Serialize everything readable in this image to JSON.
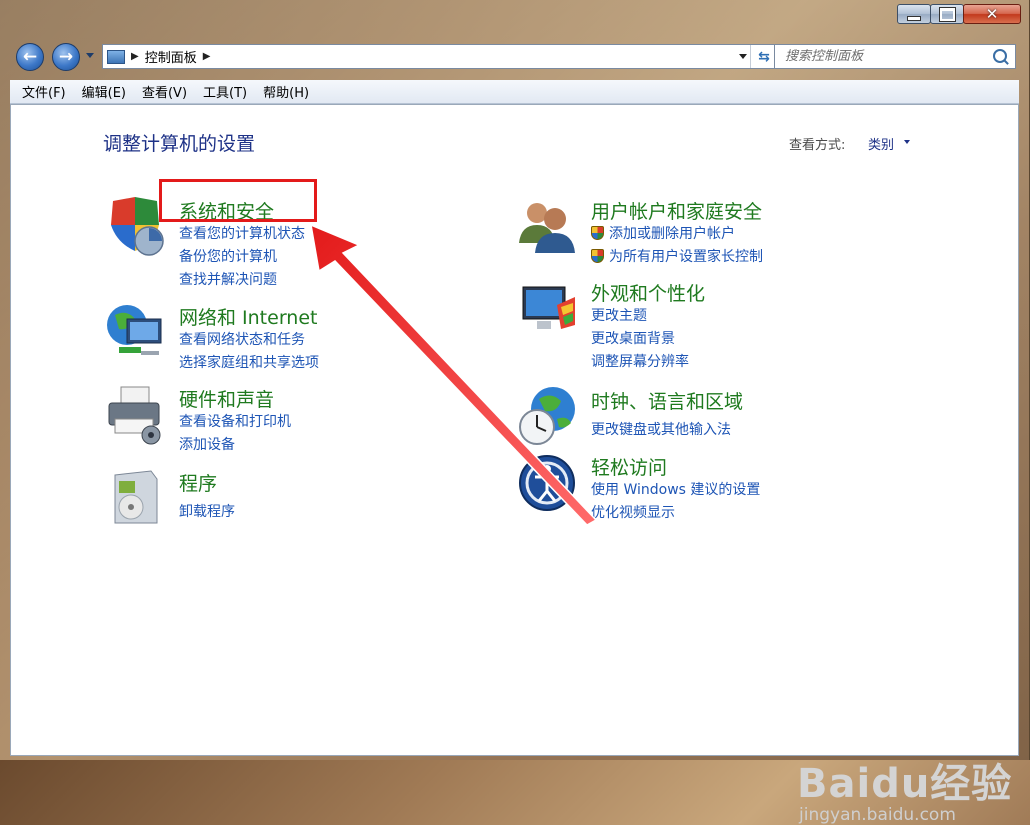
{
  "window": {
    "caption_buttons": {
      "minimize": "minimize",
      "maximize": "maximize",
      "close": "close"
    }
  },
  "address_bar": {
    "breadcrumb": "控制面板",
    "icon": "control-panel-icon"
  },
  "search": {
    "placeholder": "搜索控制面板"
  },
  "menu": {
    "items": [
      "文件(F)",
      "编辑(E)",
      "查看(V)",
      "工具(T)",
      "帮助(H)"
    ]
  },
  "page": {
    "title": "调整计算机的设置",
    "view_by_label": "查看方式:",
    "view_by_value": "类别"
  },
  "categories": {
    "system_security": {
      "title": "系统和安全",
      "icon": "shield-icon",
      "links": [
        "查看您的计算机状态",
        "备份您的计算机",
        "查找并解决问题"
      ]
    },
    "network": {
      "title": "网络和 Internet",
      "icon": "network-icon",
      "links": [
        "查看网络状态和任务",
        "选择家庭组和共享选项"
      ]
    },
    "hardware": {
      "title": "硬件和声音",
      "icon": "printer-icon",
      "links": [
        "查看设备和打印机",
        "添加设备"
      ]
    },
    "programs": {
      "title": "程序",
      "icon": "programs-icon",
      "links": [
        "卸载程序"
      ]
    },
    "user_accounts": {
      "title": "用户帐户和家庭安全",
      "icon": "users-icon",
      "links": [
        "添加或删除用户帐户",
        "为所有用户设置家长控制"
      ]
    },
    "appearance": {
      "title": "外观和个性化",
      "icon": "monitor-icon",
      "links": [
        "更改主题",
        "更改桌面背景",
        "调整屏幕分辨率"
      ]
    },
    "clock": {
      "title": "时钟、语言和区域",
      "icon": "clock-globe-icon",
      "links": [
        "更改键盘或其他输入法"
      ]
    },
    "ease": {
      "title": "轻松访问",
      "icon": "ease-of-access-icon",
      "links": [
        "使用 Windows 建议的设置",
        "优化视频显示"
      ]
    }
  },
  "annotation": {
    "highlight_color": "#e31a1a",
    "arrow_color": "#e31a1a"
  },
  "watermark": {
    "logo": "Baidu经验",
    "url": "jingyan.baidu.com"
  }
}
